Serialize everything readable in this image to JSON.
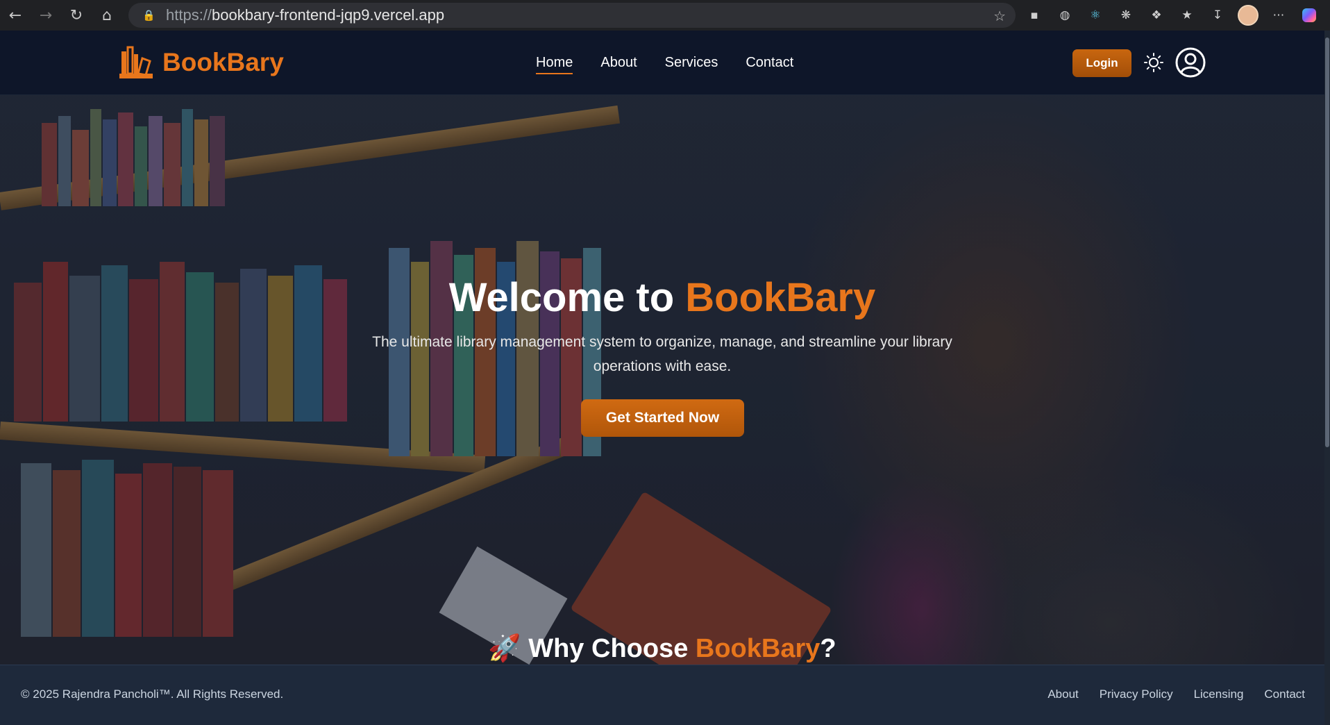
{
  "browser": {
    "url_protocol": "https://",
    "url_host": "bookbary-frontend-jqp9.vercel.app"
  },
  "site": {
    "brand": "BookBary",
    "nav": [
      "Home",
      "About",
      "Services",
      "Contact"
    ],
    "active_nav": "Home",
    "login_label": "Login"
  },
  "hero": {
    "title_prefix": "Welcome to ",
    "title_brand": "BookBary",
    "subtitle": "The ultimate library management system to organize, manage, and streamline your library operations with ease.",
    "cta_label": "Get Started Now",
    "next_section_prefix": "🚀 Why Choose ",
    "next_section_brand": "BookBary",
    "next_section_suffix": "?"
  },
  "footer": {
    "copyright": "© 2025 Rajendra Pancholi™. All Rights Reserved.",
    "links": [
      "About",
      "Privacy Policy",
      "Licensing",
      "Contact"
    ]
  },
  "colors": {
    "accent": "#e8761c",
    "header_bg": "#0e1629",
    "footer_bg": "#1e293b"
  }
}
